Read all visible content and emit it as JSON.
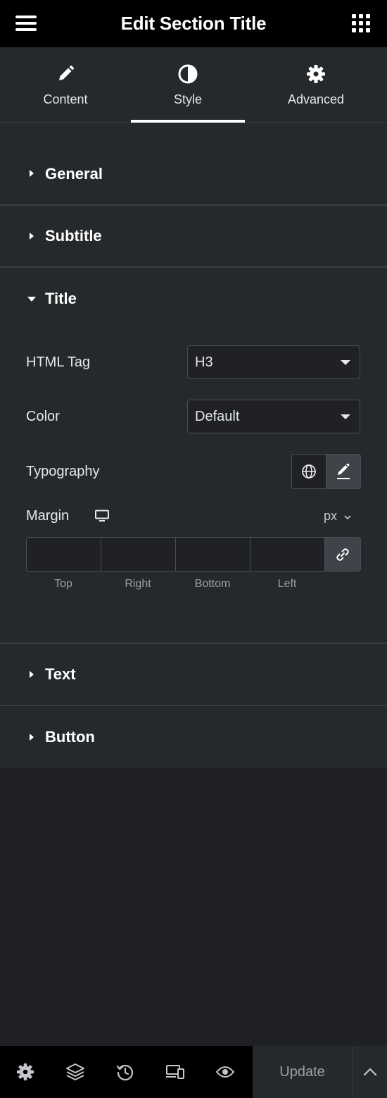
{
  "header": {
    "title": "Edit Section Title",
    "menu_icon": "hamburger-icon",
    "apps_icon": "grid-icon"
  },
  "tabs": [
    {
      "label": "Content",
      "icon": "pencil-icon",
      "active": false
    },
    {
      "label": "Style",
      "icon": "contrast-icon",
      "active": true
    },
    {
      "label": "Advanced",
      "icon": "gear-icon",
      "active": false
    }
  ],
  "sections": {
    "general": {
      "label": "General",
      "expanded": false
    },
    "subtitle": {
      "label": "Subtitle",
      "expanded": false
    },
    "title": {
      "label": "Title",
      "expanded": true,
      "html_tag": {
        "label": "HTML Tag",
        "value": "H3"
      },
      "color": {
        "label": "Color",
        "value": "Default"
      },
      "typography": {
        "label": "Typography"
      },
      "margin": {
        "label": "Margin",
        "unit": "px",
        "device_icon": "desktop-icon",
        "fields": [
          {
            "label": "Top",
            "value": ""
          },
          {
            "label": "Right",
            "value": ""
          },
          {
            "label": "Bottom",
            "value": ""
          },
          {
            "label": "Left",
            "value": ""
          }
        ],
        "link_icon": "link-icon"
      }
    },
    "text": {
      "label": "Text",
      "expanded": false
    },
    "button": {
      "label": "Button",
      "expanded": false
    }
  },
  "footer": {
    "icons": [
      "settings-icon",
      "layers-icon",
      "history-icon",
      "responsive-icon",
      "preview-icon"
    ],
    "update_label": "Update",
    "expand_icon": "chevron-up-icon"
  },
  "colors": {
    "panel_bg": "#26292c",
    "header_bg": "#000000",
    "text": "#e6e8ea",
    "border": "#3a3d41"
  }
}
